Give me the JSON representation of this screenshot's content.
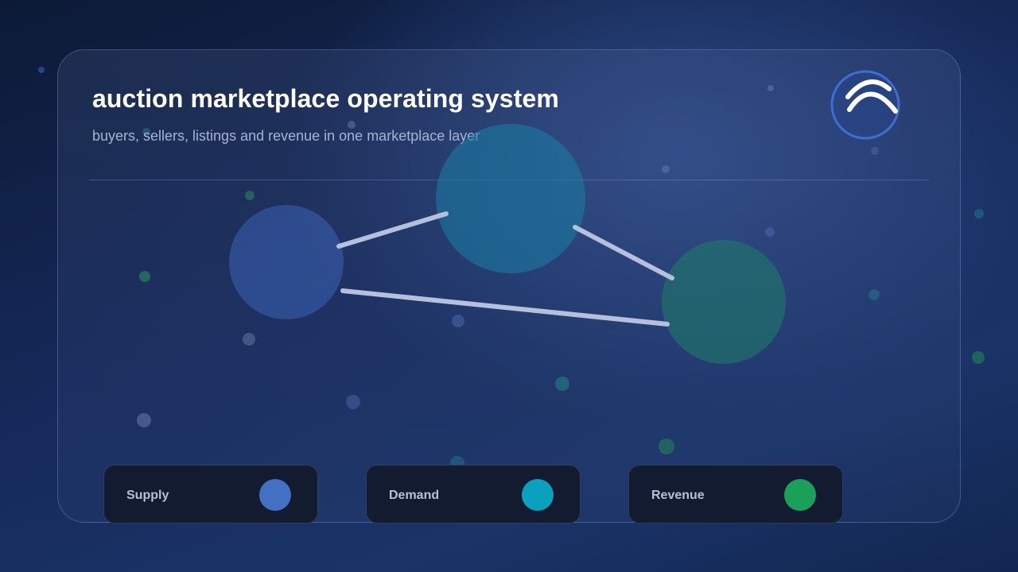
{
  "title": "auction marketplace operating system",
  "subtitle": "buyers, sellers, listings and revenue in one marketplace layer",
  "colors": {
    "supply": "#4470c4",
    "demand": "#0aa0be",
    "revenue": "#1aa058",
    "accent": "#3d6fd1"
  },
  "legend": [
    {
      "label": "Supply",
      "color": "#4470c4"
    },
    {
      "label": "Demand",
      "color": "#0aa0be"
    },
    {
      "label": "Revenue",
      "color": "#1aa058"
    }
  ],
  "diagram": {
    "nodes": [
      "supply",
      "demand",
      "revenue"
    ],
    "edges": [
      [
        "supply",
        "demand"
      ],
      [
        "demand",
        "revenue"
      ],
      [
        "supply",
        "revenue"
      ]
    ]
  },
  "icons": {
    "logo": "arc-logo-icon"
  }
}
